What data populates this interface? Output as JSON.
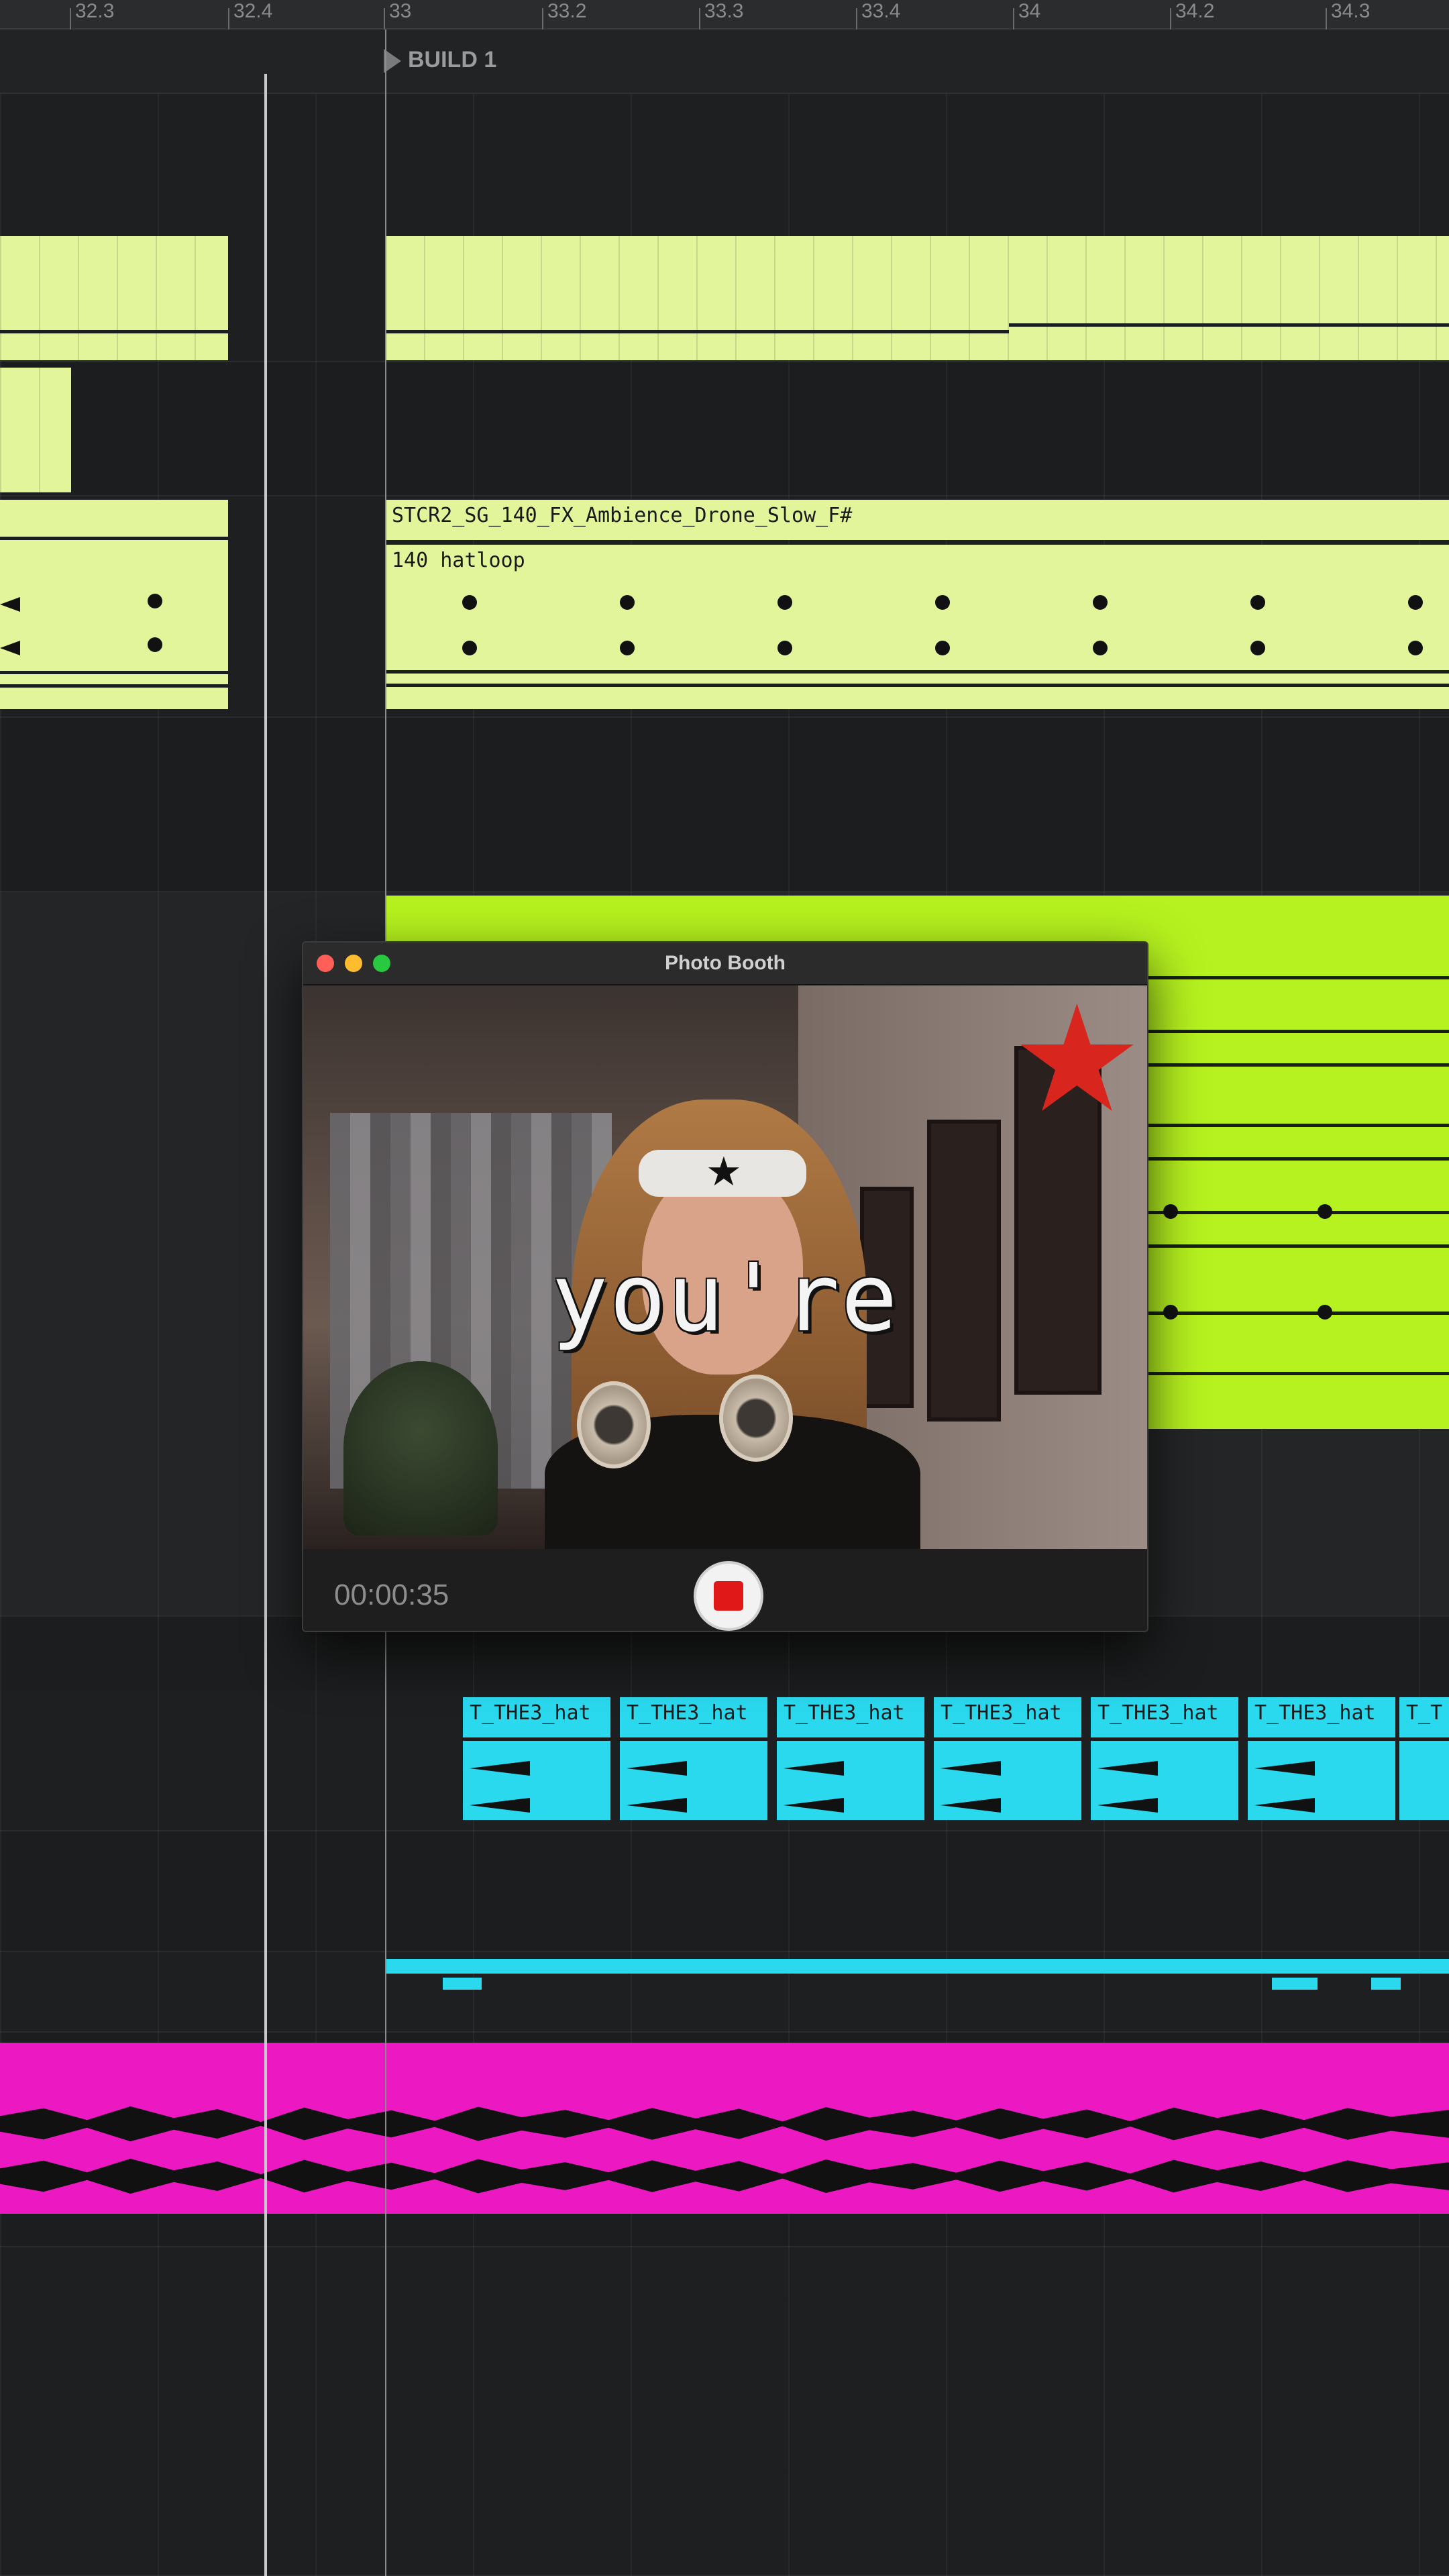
{
  "ruler": {
    "ticks": [
      "32.3",
      "32.4",
      "33",
      "33.2",
      "33.3",
      "33.4",
      "34",
      "34.2",
      "34.3"
    ]
  },
  "locator": {
    "label": "BUILD 1"
  },
  "clips": {
    "ambience_name": "STCR2_SG_140_FX_Ambience_Drone_Slow_F#",
    "hatloop_name": "140 hatloop",
    "hat_clip_name": "T_THE3_hat",
    "hat_clip_name_short": "T_T"
  },
  "colors": {
    "yellow_clip": "#e3f59b",
    "lime_clip": "#b6f21f",
    "cyan_clip": "#2ad9ee",
    "magenta_clip": "#ec19c2",
    "record_button": "#e01818"
  },
  "photo_booth": {
    "title": "Photo Booth",
    "caption": "you're",
    "timer": "00:00:35",
    "record_state": "recording"
  }
}
